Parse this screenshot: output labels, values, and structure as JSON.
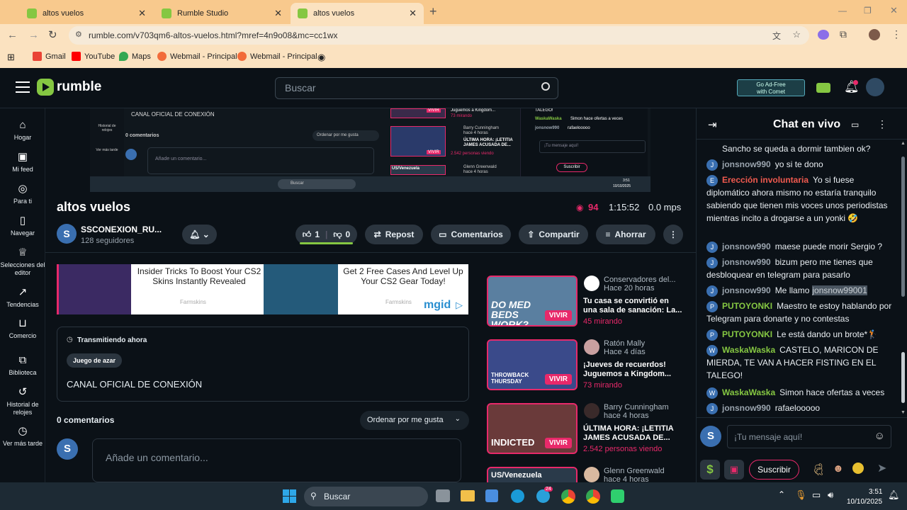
{
  "browser": {
    "tabs": [
      {
        "title": "altos vuelos"
      },
      {
        "title": "Rumble Studio"
      },
      {
        "title": "altos vuelos"
      }
    ],
    "url": "rumble.com/v703qm6-altos-vuelos.html?mref=4n9o08&mc=cc1wx",
    "bookmarks": [
      "Gmail",
      "YouTube",
      "Maps",
      "Webmail - Principal",
      "Webmail - Principal"
    ]
  },
  "header": {
    "logo": "rumble",
    "search_placeholder": "Buscar",
    "adfree_line1": "Go Ad-Free",
    "adfree_line2": "with Comet"
  },
  "leftnav": [
    {
      "label": "Hogar",
      "icon": "home-icon"
    },
    {
      "label": "Mi feed",
      "icon": "feed-icon"
    },
    {
      "label": "Para ti",
      "icon": "target-icon"
    },
    {
      "label": "Navegar",
      "icon": "browse-icon"
    },
    {
      "label": "Selecciones del editor",
      "icon": "award-icon"
    },
    {
      "label": "Tendencias",
      "icon": "trend-icon"
    },
    {
      "label": "Comercio",
      "icon": "bag-icon"
    },
    {
      "label": "Biblioteca",
      "icon": "library-icon"
    },
    {
      "label": "Historial de relojes",
      "icon": "history-icon"
    },
    {
      "label": "Ver más tarde",
      "icon": "clock-icon"
    }
  ],
  "stream_preview": {
    "channel_line": "CANAL OFICIAL DE CONEXIÓN",
    "comments": "0 comentarios",
    "sort": "Ordenar por me gusta",
    "comment_placeholder": "Añade un comentario...",
    "mini_chat": [
      {
        "user": "",
        "text": "TALEGO!"
      },
      {
        "user": "WaskaWaska",
        "text": "Simon hace ofertas a veces"
      },
      {
        "user": "jonsnow990",
        "text": "rafaelooooo"
      }
    ],
    "mini_input": "¡Tu mensaje aquí!",
    "mini_subscribe": "Suscribir",
    "mini_search": "Buscar",
    "mini_clock": "3:51",
    "mini_date": "10/10/2025",
    "mini_nav": [
      "Historial de relojes",
      "Ver más tarde"
    ],
    "mini_cards": [
      {
        "tag": "VIVIR",
        "title": "Juguemos a Kingdom...",
        "views": "73 mirando"
      },
      {
        "author": "Barry Cunningham",
        "time": "hace 4 horas",
        "title": "ÚLTIMA HORA: ¡LETITIA JAMES ACUSADA DE...",
        "views": "2.542 personas viendo",
        "tag": "VIVIR"
      },
      {
        "author": "Glenn Greenwald",
        "time": "hace 4 horas",
        "tag": "US/Venezuela"
      }
    ]
  },
  "video": {
    "title": "altos vuelos",
    "viewers": "94",
    "duration": "1:15:52",
    "bitrate": "0.0 mps",
    "channel": "SSCONEXION_RU...",
    "followers": "128 seguidores",
    "likes": "1",
    "dislikes": "0",
    "like_ratio": 1.0,
    "repost": "Repost",
    "comments_btn": "Comentarios",
    "share": "Compartir",
    "save": "Ahorrar"
  },
  "ads": [
    {
      "title": "Insider Tricks To Boost Your CS2 Skins Instantly Revealed",
      "source": "Farmskins"
    },
    {
      "title": "Get 2 Free Cases And Level Up Your CS2 Gear Today!",
      "source": "Farmskins"
    }
  ],
  "ad_brand": "mgid",
  "live_box": {
    "status": "Transmitiendo ahora",
    "category": "Juego de azar",
    "description": "CANAL OFICIAL DE CONEXIÓN"
  },
  "comments": {
    "count": "0 comentarios",
    "sort": "Ordenar por me gusta",
    "placeholder": "Añade un comentario...",
    "avatar": "S"
  },
  "related": [
    {
      "author": "Conservadores del...",
      "time": "Hace 20 horas",
      "title": "Tu casa se convirtió en una sala de sanación: La...",
      "views": "45 mirando",
      "tag": "VIVIR",
      "thumb_text": "DO MED BEDS WORK?"
    },
    {
      "author": "Ratón Mally",
      "time": "Hace 4 días",
      "title": "¡Jueves de recuerdos! Juguemos a Kingdom...",
      "views": "73 mirando",
      "tag": "VIVIR",
      "thumb_text": "THROWBACK THURSDAY"
    },
    {
      "author": "Barry Cunningham",
      "time": "hace 4 horas",
      "title": "ÚLTIMA HORA: ¡LETITIA JAMES ACUSADA DE...",
      "views": "2.542 personas viendo",
      "tag": "VIVIR",
      "thumb_text": "INDICTED"
    },
    {
      "author": "Glenn Greenwald",
      "time": "hace 4 horas",
      "title": "",
      "views": "",
      "tag": "",
      "thumb_text": "US/Venezuela"
    }
  ],
  "chat": {
    "title": "Chat en vivo",
    "messages": [
      {
        "user": "",
        "color": "#e9eef2",
        "avatar": "",
        "text": "Sancho se queda a dormir tambien ok?"
      },
      {
        "user": "jonsnow990",
        "color": "#9aa4ae",
        "avatar": "J",
        "text": "yo si te dono"
      },
      {
        "user": "Erección involuntaria",
        "color": "#f05a4f",
        "avatar": "E",
        "text": "Yo si fuese diplomático ahora mismo no estaría tranquilo sabiendo que tienen mis voces unos periodistas mientras incito a drogarse a un yonki 🤣"
      },
      {
        "user": "jonsnow990",
        "color": "#9aa4ae",
        "avatar": "J",
        "text": "maese puede morir Sergio ?"
      },
      {
        "user": "jonsnow990",
        "color": "#9aa4ae",
        "avatar": "J",
        "text": "bizum pero me tienes que desbloquear en telegram para pasarlo"
      },
      {
        "user": "jonsnow990",
        "color": "#9aa4ae",
        "avatar": "J",
        "text": "Me llamo",
        "highlight": "jonsnow99001"
      },
      {
        "user": "PUTOYONKI",
        "color": "#85c742",
        "avatar": "P",
        "text": "Maestro te estoy hablando por Telegram para donarte y no contestas"
      },
      {
        "user": "PUTOYONKI",
        "color": "#85c742",
        "avatar": "P",
        "text": "Le está dando un brote*🏌"
      },
      {
        "user": "WaskaWaska",
        "color": "#85c742",
        "avatar": "W",
        "text": "CASTELO, MARICON DE MIERDA, TE VAN A HACER FISTING EN EL TALEGO!"
      },
      {
        "user": "WaskaWaska",
        "color": "#85c742",
        "avatar": "W",
        "text": "Simon hace ofertas a veces"
      },
      {
        "user": "jonsnow990",
        "color": "#9aa4ae",
        "avatar": "J",
        "text": "rafaelooooo"
      }
    ],
    "input_placeholder": "¡Tu mensaje aquí!",
    "avatar": "S",
    "subscribe": "Suscribir"
  },
  "taskbar": {
    "search": "Buscar",
    "time": "3:51",
    "date": "10/10/2025",
    "telegram_badge": "24"
  }
}
